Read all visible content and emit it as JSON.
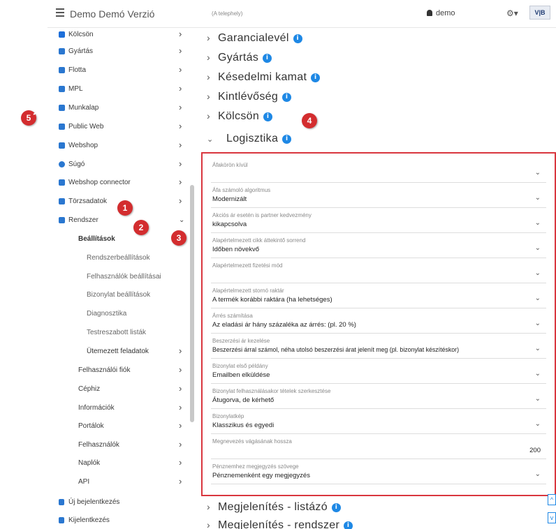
{
  "header": {
    "app_title": "Demo Demó Verzió",
    "app_subtitle": "(A telephely)",
    "user": "demo",
    "gear": "⚙▾",
    "logo": "V|B"
  },
  "sidebar": {
    "items": [
      {
        "label": "Kölcsön",
        "icon": "anchor-icon",
        "color": "#1e6fd9"
      },
      {
        "label": "Gyártás",
        "icon": "cogs-icon",
        "color": "#1e6fd9"
      },
      {
        "label": "Flotta",
        "icon": "car-icon",
        "color": "#1e6fd9"
      },
      {
        "label": "MPL",
        "icon": "mpl-icon",
        "color": "#1e6fd9"
      },
      {
        "label": "Munkalap",
        "icon": "file-icon",
        "color": "#1e6fd9"
      },
      {
        "label": "Public Web",
        "icon": "monitor-icon",
        "color": "#1e6fd9"
      },
      {
        "label": "Webshop",
        "icon": "cart-icon",
        "color": "#1e6fd9"
      },
      {
        "label": "Súgó",
        "icon": "help-icon",
        "color": "#1e6fd9"
      },
      {
        "label": "Webshop connector",
        "icon": "cart-icon",
        "color": "#1e6fd9"
      },
      {
        "label": "Törzsadatok",
        "icon": "database-icon",
        "color": "#1e6fd9"
      },
      {
        "label": "Rendszer",
        "icon": "cogs-icon",
        "color": "#1e6fd9"
      }
    ],
    "system_sub": {
      "settings": "Beállítások",
      "settings_children": [
        "Rendszerbeállítások",
        "Felhasználók beállításai",
        "Bizonylat beállítások",
        "Diagnosztika",
        "Testreszabott listák",
        "Ütemezett feladatok"
      ],
      "others": [
        "Felhasználói fiók",
        "Céphiz",
        "Információk",
        "Portálok",
        "Felhasználók",
        "Naplók",
        "API"
      ]
    },
    "footer": {
      "new_login": "Új bejelentkezés",
      "logout": "Kijelentkezés"
    }
  },
  "main": {
    "sections_top": [
      "Garancialevél",
      "Gyártás",
      "Késedelmi kamat",
      "Kintlévőség",
      "Kölcsön"
    ],
    "open_section": "Logisztika",
    "fields": [
      {
        "label": "Áfakörön kívül",
        "value": ""
      },
      {
        "label": "Áfa számoló algoritmus",
        "value": "Modernizált"
      },
      {
        "label": "Akciós ár esetén is partner kedvezmény",
        "value": "kikapcsolva"
      },
      {
        "label": "Alapértelmezett cikk áttekintő sorrend",
        "value": "Időben növekvő"
      },
      {
        "label": "Alapértelmezett fizetési mód",
        "value": ""
      },
      {
        "label": "Alapértelmezett stornó raktár",
        "value": "A termék korábbi raktára (ha lehetséges)"
      },
      {
        "label": "Árrés számítása",
        "value": "Az eladási ár hány százaléka az árrés: (pl. 20 %)"
      },
      {
        "label": "Beszerzési ár kezelése",
        "value": "Beszerzési árral számol, néha utolsó beszerzési árat jelenít meg (pl. bizonylat készítéskor)"
      },
      {
        "label": "Bizonylat első példány",
        "value": "Emailben elküldése"
      },
      {
        "label": "Bizonylat felhasználásakor tételek szerkesztése",
        "value": "Átugorva, de kérhető"
      },
      {
        "label": "Bizonylatkép",
        "value": "Klasszikus és egyedi"
      },
      {
        "label": "Megnevezés vágásának hossza",
        "value": "200"
      },
      {
        "label": "Pénznemhez megjegyzés szövege",
        "value": "Pénznemenként egy megjegyzés"
      }
    ],
    "sections_bottom": [
      "Megjelenítés - listázó",
      "Megjelenítés - rendszer"
    ]
  },
  "badges": [
    "1",
    "2",
    "3",
    "4",
    "5"
  ],
  "colors": {
    "accent": "#1e88e5",
    "highlight": "#d9363e",
    "badge": "#d32d2f"
  }
}
